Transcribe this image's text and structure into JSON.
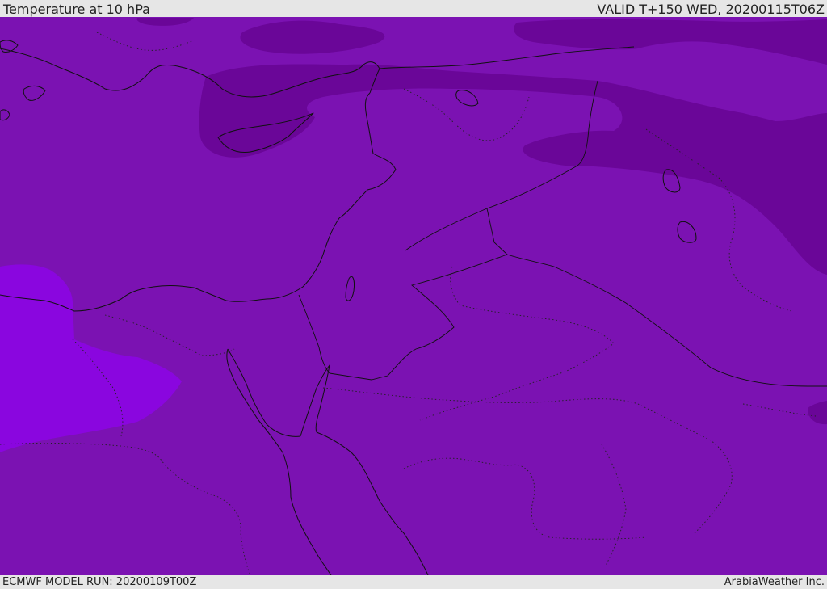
{
  "header": {
    "title": "Temperature at 10 hPa",
    "valid": "VALID T+150 WED, 20200115T06Z"
  },
  "footer": {
    "model_run": "ECMWF MODEL RUN: 20200109T00Z",
    "credit": "ArabiaWeather Inc."
  },
  "map": {
    "region": "Eastern Mediterranean / Middle East",
    "colors": {
      "base": "#7b12b2",
      "cold": "#6a0698",
      "warm": "#8a06df",
      "coast": "#111111"
    }
  }
}
